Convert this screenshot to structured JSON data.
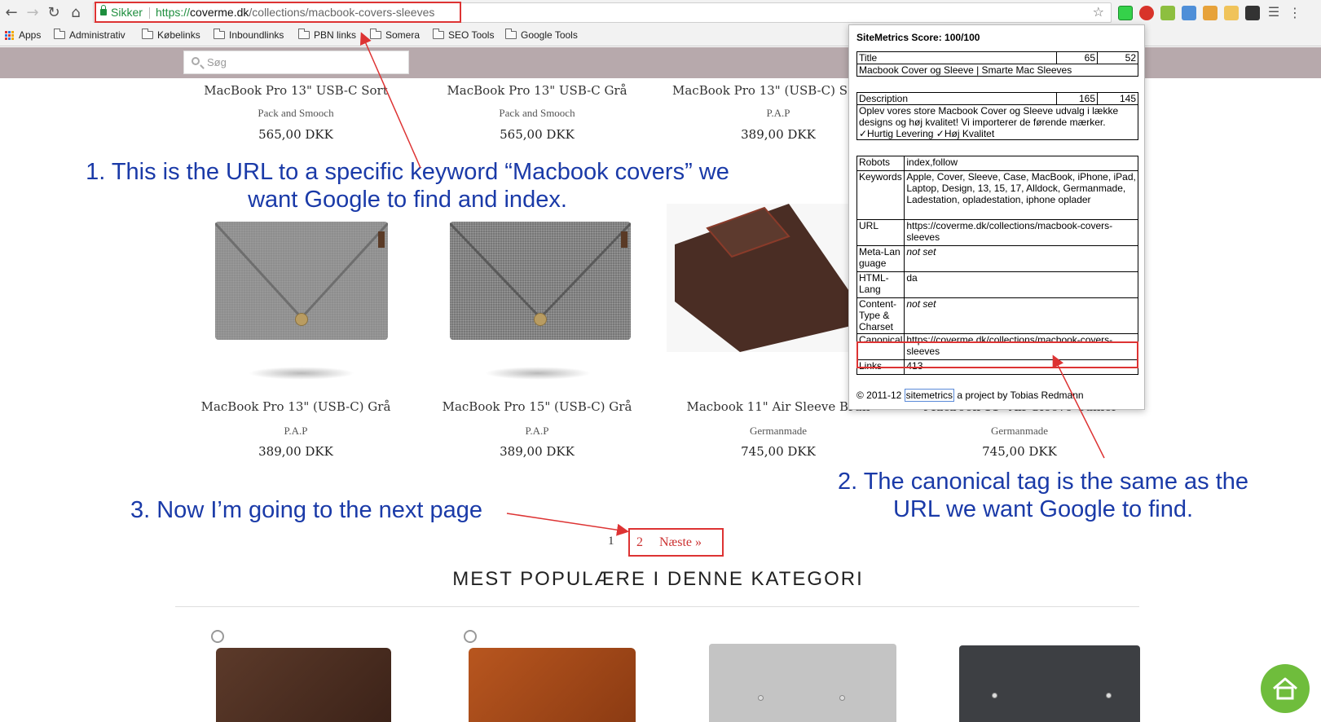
{
  "browser": {
    "secure_label": "Sikker",
    "url_scheme": "https://",
    "url_host": "coverme.dk",
    "url_path": "/collections/macbook-covers-sleeves"
  },
  "bookmarks": [
    "Apps",
    "Administrativ",
    "Købelinks",
    "Inboundlinks",
    "PBN links",
    "Somera",
    "SEO Tools",
    "Google Tools"
  ],
  "site": {
    "search_placeholder": "Søg",
    "products_row1": [
      {
        "name": "MacBook Pro 13\" USB-C Sort",
        "brand": "Pack and Smooch",
        "price": "565,00 DKK"
      },
      {
        "name": "MacBook Pro 13\" USB-C Grå",
        "brand": "Pack and Smooch",
        "price": "565,00 DKK"
      },
      {
        "name": "MacBook Pro 13\" (USB-C) S",
        "brand": "P.A.P",
        "price": "389,00 DKK"
      }
    ],
    "products_row2": [
      {
        "name": "MacBook Pro 13\" (USB-C) Grå",
        "brand": "P.A.P",
        "price": "389,00 DKK"
      },
      {
        "name": "MacBook Pro 15\" (USB-C) Grå",
        "brand": "P.A.P",
        "price": "389,00 DKK"
      },
      {
        "name": "Macbook 11\" Air Sleeve Brun",
        "brand": "Germanmade",
        "price": "745,00 DKK"
      },
      {
        "name": "Macbook 11\" Air Sleeve Camel",
        "brand": "Germanmade",
        "price": "745,00 DKK"
      }
    ],
    "pager": {
      "page1": "1",
      "page2": "2",
      "next": "Næste »"
    },
    "section_title": "MEST POPULÆRE I DENNE KATEGORI"
  },
  "annotations": {
    "a1_line1": "1. This is the URL to a specific keyword “Macbook covers” we",
    "a1_line2": "want Google to find and index.",
    "a2_line1": "2. The canonical tag is the same as the",
    "a2_line2": "URL we want Google to find.",
    "a3": "3. Now I’m going to the next page"
  },
  "sitemetrics": {
    "score": "SiteMetrics Score: 100/100",
    "title_label": "Title",
    "title_n1": "65",
    "title_n2": "52",
    "title_value": "Macbook Cover og Sleeve | Smarte Mac Sleeves",
    "desc_label": "Description",
    "desc_n1": "165",
    "desc_n2": "145",
    "desc_value": "Oplev vores store Macbook Cover og Sleeve udvalg i lække designs og høj kvalitet! Vi importerer de førende mærker. ✓Hurtig Levering ✓Høj Kvalitet",
    "rows": [
      {
        "label": "Robots",
        "value": "index,follow"
      },
      {
        "label": "Keywords",
        "value": "Apple, Cover, Sleeve, Case, MacBook, iPhone, iPad, Laptop, Design, 13, 15, 17, Alldock, Germanmade, Ladestation, opladestation, iphone oplader"
      },
      {
        "label": "URL",
        "value": "https://coverme.dk/collections/macbook-covers-sleeves"
      },
      {
        "label": "Meta-Language",
        "value": "not set"
      },
      {
        "label": "HTML-Lang",
        "value": "da"
      },
      {
        "label": "Content-Type & Charset",
        "value": "not set"
      },
      {
        "label": "Canonical",
        "value": "https://coverme.dk/collections/macbook-covers-sleeves"
      },
      {
        "label": "Links",
        "value": "413"
      }
    ],
    "footer_prefix": "© 2011-12",
    "footer_link": "sitemetrics",
    "footer_suffix": "a project by Tobias Redmann"
  },
  "colors": {
    "header_bg": "#b7a9ac",
    "annotation_blue": "#1a3aa8",
    "highlight_red": "#dd3333",
    "fab_green": "#6fbd3c"
  }
}
